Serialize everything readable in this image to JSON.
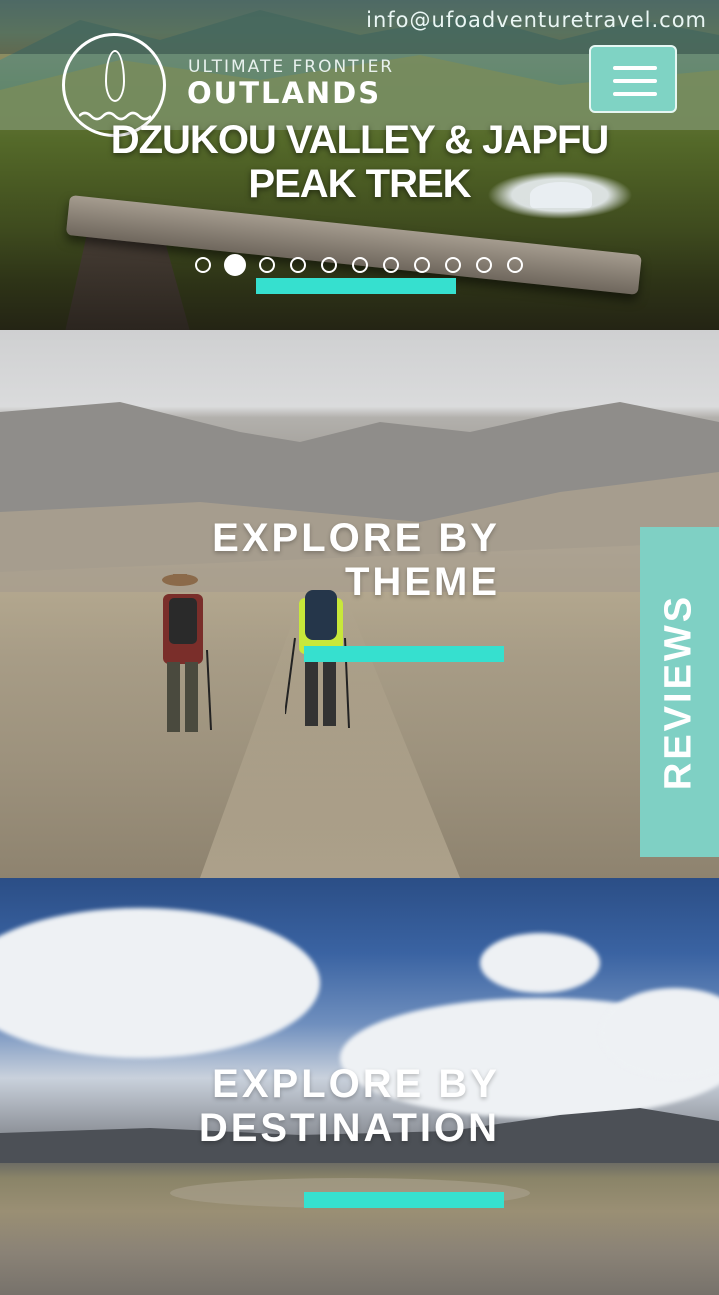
{
  "header": {
    "email": "info@ufoadventuretravel.com",
    "brand_small": "ULTIMATE FRONTIER",
    "brand_big": "OUTLANDS",
    "menu_icon": "hamburger-icon"
  },
  "hero": {
    "title_line1": "DZUKOU VALLEY & JAPFU",
    "title_line2": "PEAK TREK",
    "slide_count": 11,
    "active_slide": 2
  },
  "sections": {
    "theme": {
      "line1": "EXPLORE BY",
      "line2": "THEME"
    },
    "destination": {
      "line1": "EXPLORE BY",
      "line2": "DESTINATION"
    }
  },
  "reviews_tab": {
    "label": "REVIEWS"
  },
  "colors": {
    "accent": "#36e0cf",
    "tab": "#7fd0c4",
    "menu_button": "#7fd3c4"
  }
}
